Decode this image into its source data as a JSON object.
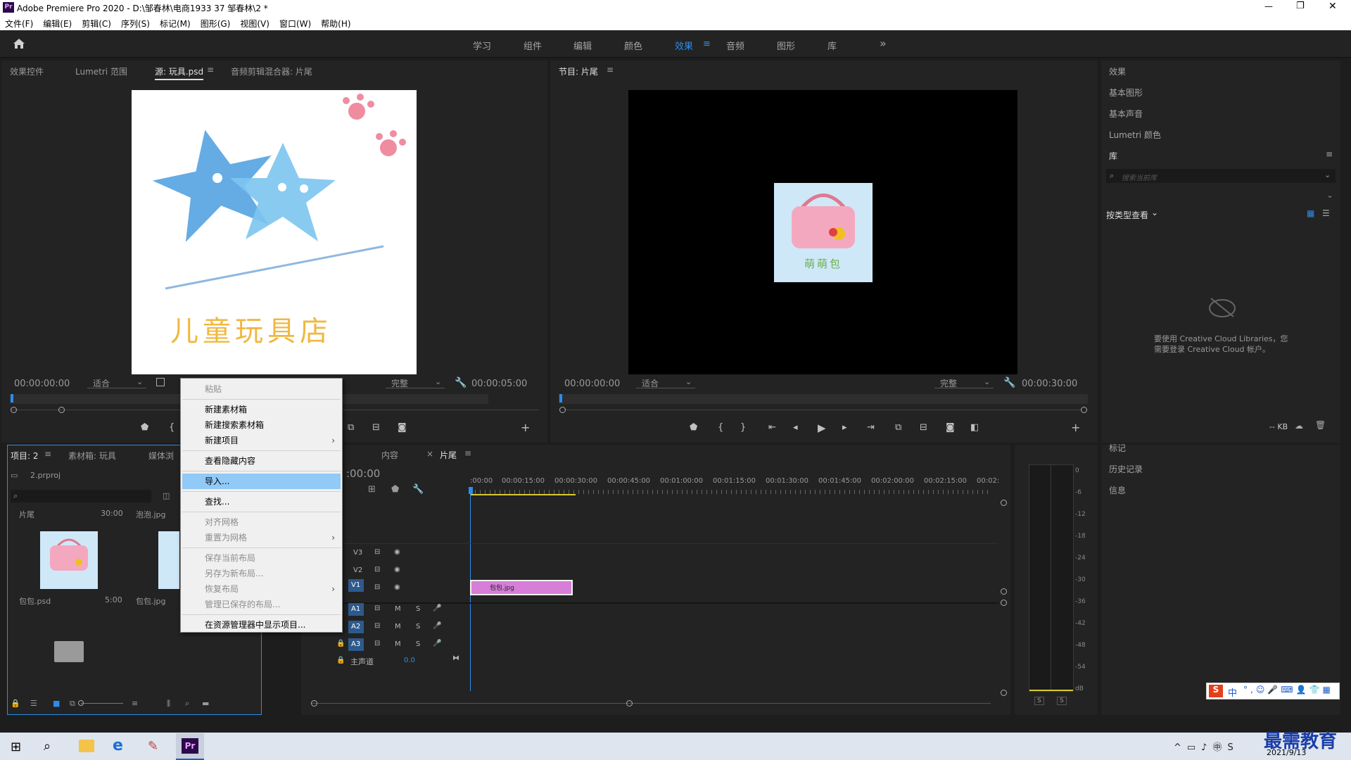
{
  "window": {
    "title": "Adobe Premiere Pro 2020 - D:\\邹春林\\电商1933 37 邹春林\\2 *",
    "app_badge": "Pr",
    "minimize": "—",
    "maximize": "❐",
    "close": "✕"
  },
  "menu": [
    "文件(F)",
    "编辑(E)",
    "剪辑(C)",
    "序列(S)",
    "标记(M)",
    "图形(G)",
    "视图(V)",
    "窗口(W)",
    "帮助(H)"
  ],
  "workspaces": {
    "items": [
      "学习",
      "组件",
      "编辑",
      "颜色",
      "效果",
      "音频",
      "图形",
      "库"
    ],
    "active": "效果",
    "more": "»"
  },
  "source_panel": {
    "tabs": [
      "效果控件",
      "Lumetri 范围",
      "源: 玩具.psd",
      "音频剪辑混合器: 片尾"
    ],
    "timecode_in": "00:00:00:00",
    "fit": "适合",
    "quality": "完整",
    "duration": "00:00:05:00",
    "image_text": "儿童玩具店"
  },
  "program_panel": {
    "tab": "节目: 片尾",
    "timecode_in": "00:00:00:00",
    "fit": "适合",
    "quality": "完整",
    "duration": "00:00:30:00",
    "image_text": "萌萌包"
  },
  "project_panel": {
    "tabs": [
      "项目: 2",
      "素材箱: 玩具",
      "媒体浏"
    ],
    "file": "2.prproj",
    "search_placeholder": "",
    "items": [
      {
        "top": "片尾",
        "top_dur": "30:00",
        "name": "包包.psd",
        "dur": "5:00"
      },
      {
        "top": "泡泡.jpg",
        "name": "包包.jpg"
      }
    ]
  },
  "context_menu": {
    "items": [
      {
        "label": "粘贴",
        "disabled": true
      },
      {
        "label": "新建素材箱"
      },
      {
        "label": "新建搜索素材箱"
      },
      {
        "label": "新建项目",
        "submenu": true
      },
      {
        "label": "查看隐藏内容"
      },
      {
        "label": "导入...",
        "selected": true
      },
      {
        "label": "查找..."
      },
      {
        "label": "对齐网格",
        "disabled": true
      },
      {
        "label": "重置为网格",
        "disabled": true,
        "submenu": true
      },
      {
        "label": "保存当前布局",
        "disabled": true
      },
      {
        "label": "另存为新布局...",
        "disabled": true
      },
      {
        "label": "恢复布局",
        "disabled": true,
        "submenu": true
      },
      {
        "label": "管理已保存的布局...",
        "disabled": true
      },
      {
        "label": "在资源管理器中显示项目..."
      }
    ]
  },
  "timeline": {
    "tabs": [
      "内容",
      "片尾"
    ],
    "timecode": ":00:00",
    "ruler": [
      ":00:00",
      "00:00:15:00",
      "00:00:30:00",
      "00:00:45:00",
      "00:01:00:00",
      "00:01:15:00",
      "00:01:30:00",
      "00:01:45:00",
      "00:02:00:00",
      "00:02:15:00",
      "00:02:"
    ],
    "video_tracks": [
      "V3",
      "V2",
      "V1"
    ],
    "audio_tracks": [
      "A1",
      "A2",
      "A3"
    ],
    "master_label": "主声道",
    "master_value": "0.0",
    "clip_name": "包包.jpg",
    "m": "M",
    "s": "S"
  },
  "meter": {
    "labels": [
      "0",
      "-6",
      "-12",
      "-18",
      "-24",
      "-30",
      "-36",
      "-42",
      "-48",
      "-54",
      "dB"
    ],
    "solo": [
      "S",
      "S"
    ]
  },
  "right_panel": {
    "items": [
      "效果",
      "基本图形",
      "基本声音",
      "Lumetri 颜色",
      "库"
    ],
    "search_placeholder": "搜索当前库",
    "view_label": "按类型查看",
    "cc_message_1": "要使用 Creative Cloud Libraries，您",
    "cc_message_2": "需要登录 Creative Cloud 帐户。",
    "kb": "-- KB",
    "lower_items": [
      "标记",
      "历史记录",
      "信息"
    ]
  },
  "taskbar": {
    "date": "2021/9/13",
    "ime": "中",
    "watermark": "最需教育"
  }
}
